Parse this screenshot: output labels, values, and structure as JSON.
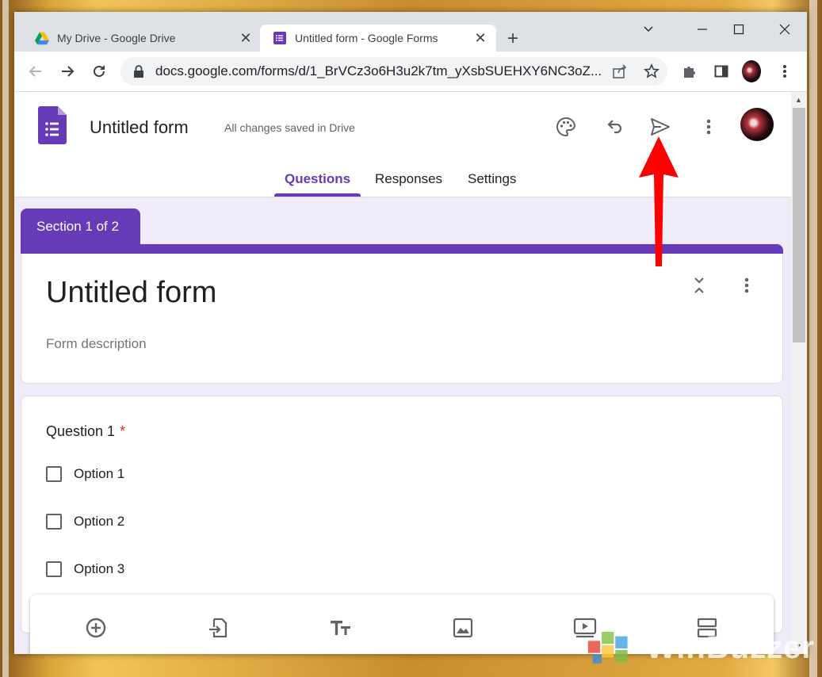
{
  "browser": {
    "tabs": [
      {
        "title": "My Drive - Google Drive",
        "active": false
      },
      {
        "title": "Untitled form - Google Forms",
        "active": true
      }
    ],
    "url_host": "docs.google.com",
    "url_path": "/forms/d/1_BrVCz3o6H3u2k7tm_yXsbSUEHXY6NC3oZ..."
  },
  "form": {
    "app_title": "Untitled form",
    "save_status": "All changes saved in Drive",
    "tabs": [
      {
        "label": "Questions",
        "active": true
      },
      {
        "label": "Responses",
        "active": false
      },
      {
        "label": "Settings",
        "active": false
      }
    ],
    "section_label": "Section 1 of 2",
    "title": "Untitled form",
    "description_placeholder": "Form description",
    "question": {
      "title": "Question 1",
      "required_mark": "*",
      "options": [
        "Option 1",
        "Option 2",
        "Option 3"
      ]
    }
  },
  "watermark": "WinBuzzer",
  "colors": {
    "accent": "#673ab7",
    "page_bg": "#f0ebf8",
    "required": "#d93025",
    "arrow": "#ff0000"
  }
}
